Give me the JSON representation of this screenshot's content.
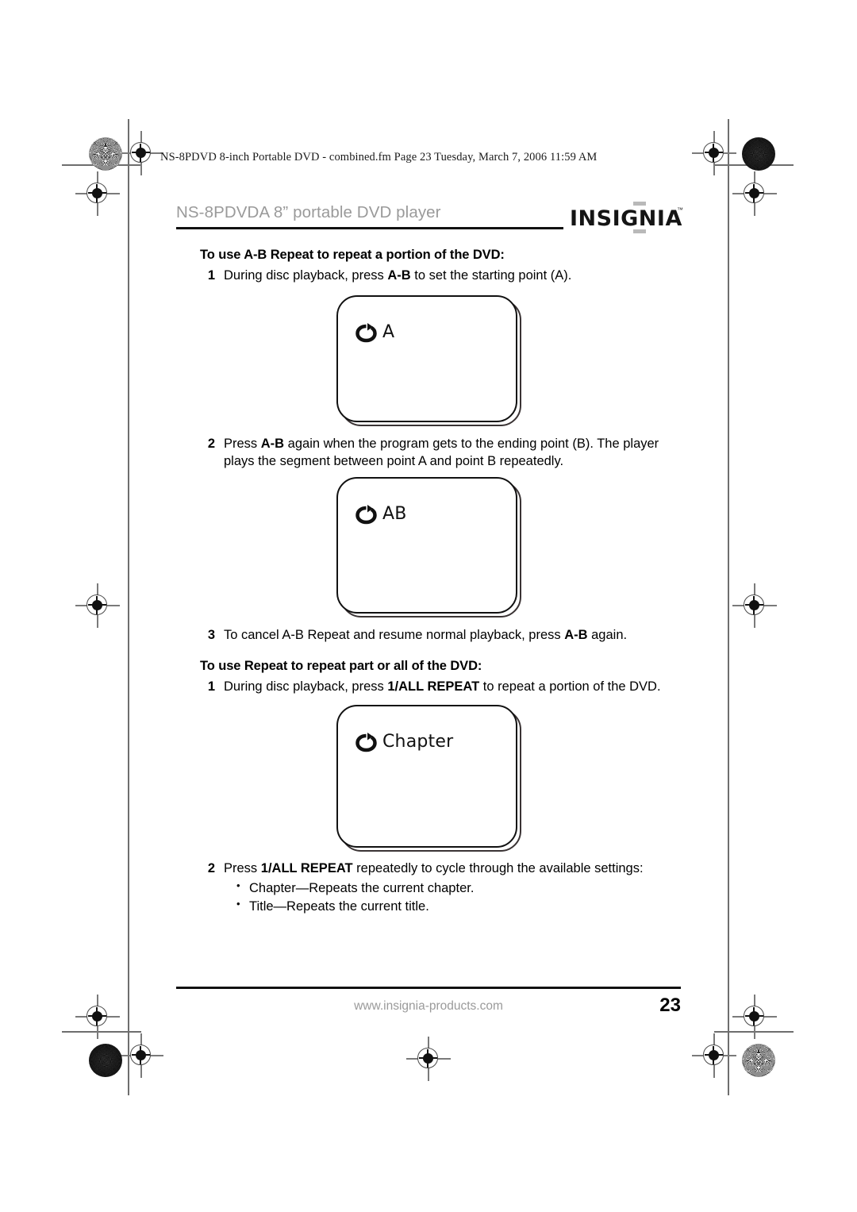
{
  "slug": {
    "text": "NS-8PDVD 8-inch Portable DVD - combined.fm  Page 23  Tuesday, March 7, 2006  11:59 AM"
  },
  "header": {
    "title": "NS-8PDVDA 8” portable DVD player",
    "logo_text": "INSIGNIA",
    "logo_tm": "™"
  },
  "sections": [
    {
      "heading": "To use A-B Repeat to repeat a portion of the DVD:",
      "steps": [
        {
          "num": "1",
          "parts": [
            {
              "t": "During disc playback, press ",
              "b": false
            },
            {
              "t": "A-B",
              "b": true
            },
            {
              "t": " to set the starting point (A).",
              "b": false
            }
          ]
        }
      ]
    }
  ],
  "step1": {
    "num": "1",
    "pre": "During disc playback, press ",
    "bold": "A-B",
    "post": " to set the starting point (A)."
  },
  "step2": {
    "num": "2",
    "pre": "Press ",
    "bold": "A-B",
    "post": " again when the program gets to the ending point (B). The player plays the segment between point A and point B repeatedly."
  },
  "step3": {
    "num": "3",
    "pre": "To cancel A-B Repeat and resume normal playback, press ",
    "bold": "A-B",
    "post": " again."
  },
  "heading1": "To use A-B Repeat to repeat a portion of the DVD:",
  "heading2": "To use Repeat to repeat part or all of the DVD:",
  "step4": {
    "num": "1",
    "pre": "During disc playback, press ",
    "bold": "1/ALL REPEAT",
    "post": " to repeat a portion of the DVD."
  },
  "step5": {
    "num": "2",
    "pre": "Press ",
    "bold": "1/ALL REPEAT",
    "post": " repeatedly to cycle through the available settings:"
  },
  "bullets": [
    "Chapter—Repeats the current chapter.",
    "Title—Repeats the current title."
  ],
  "screens": [
    {
      "icon": "repeat-icon",
      "label": "A"
    },
    {
      "icon": "repeat-icon",
      "label": "AB"
    },
    {
      "icon": "repeat-icon",
      "label": "Chapter"
    }
  ],
  "footer": {
    "url": "www.insignia-products.com",
    "page_number": "23"
  },
  "colors": {
    "ink": "#000000",
    "muted": "#9a9a9a",
    "mark": "#6e6e6e"
  }
}
